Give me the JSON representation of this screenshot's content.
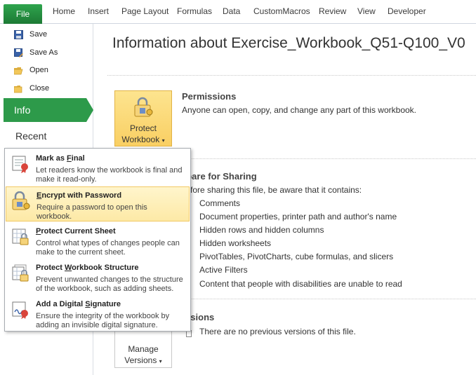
{
  "ribbon": {
    "file": "File",
    "tabs": [
      "Home",
      "Insert",
      "Page Layout",
      "Formulas",
      "Data",
      "CustomMacros",
      "Review",
      "View",
      "Developer"
    ]
  },
  "nav": {
    "save": "Save",
    "save_as": "Save As",
    "open": "Open",
    "close": "Close",
    "info": "Info",
    "recent": "Recent"
  },
  "main": {
    "title": "Information about Exercise_Workbook_Q51-Q100_V0",
    "permissions": {
      "button_line1": "Protect",
      "button_line2": "Workbook",
      "heading": "Permissions",
      "text": "Anyone can open, copy, and change any part of this workbook."
    },
    "prepare": {
      "heading": "epare for Sharing",
      "intro": "fore sharing this file, be aware that it contains:",
      "bullets": [
        "Comments",
        "Document properties, printer path and author's name",
        "Hidden rows and hidden columns",
        "Hidden worksheets",
        "PivotTables, PivotCharts, cube formulas, and slicers",
        "Active Filters",
        "Content that people with disabilities are unable to read"
      ]
    },
    "versions": {
      "heading": "ersions",
      "text": "There are no previous versions of this file.",
      "button_line1": "Manage",
      "button_line2": "Versions"
    }
  },
  "menu": {
    "items": [
      {
        "title": "Mark as Final",
        "desc": "Let readers know the workbook is final and make it read-only.",
        "icon": "ribbon-seal-icon"
      },
      {
        "title": "Encrypt with Password",
        "desc": "Require a password to open this workbook.",
        "icon": "lock-key-icon"
      },
      {
        "title": "Protect Current Sheet",
        "desc": "Control what types of changes people can make to the current sheet.",
        "icon": "sheet-lock-icon"
      },
      {
        "title": "Protect Workbook Structure",
        "desc": "Prevent unwanted changes to the structure of the workbook, such as adding sheets.",
        "icon": "workbook-lock-icon"
      },
      {
        "title": "Add a Digital Signature",
        "desc": "Ensure the integrity of the workbook by adding an invisible digital signature.",
        "icon": "signature-icon"
      }
    ]
  },
  "colors": {
    "accent_green": "#2d9a4a",
    "highlight_yellow": "#fde9a6"
  }
}
